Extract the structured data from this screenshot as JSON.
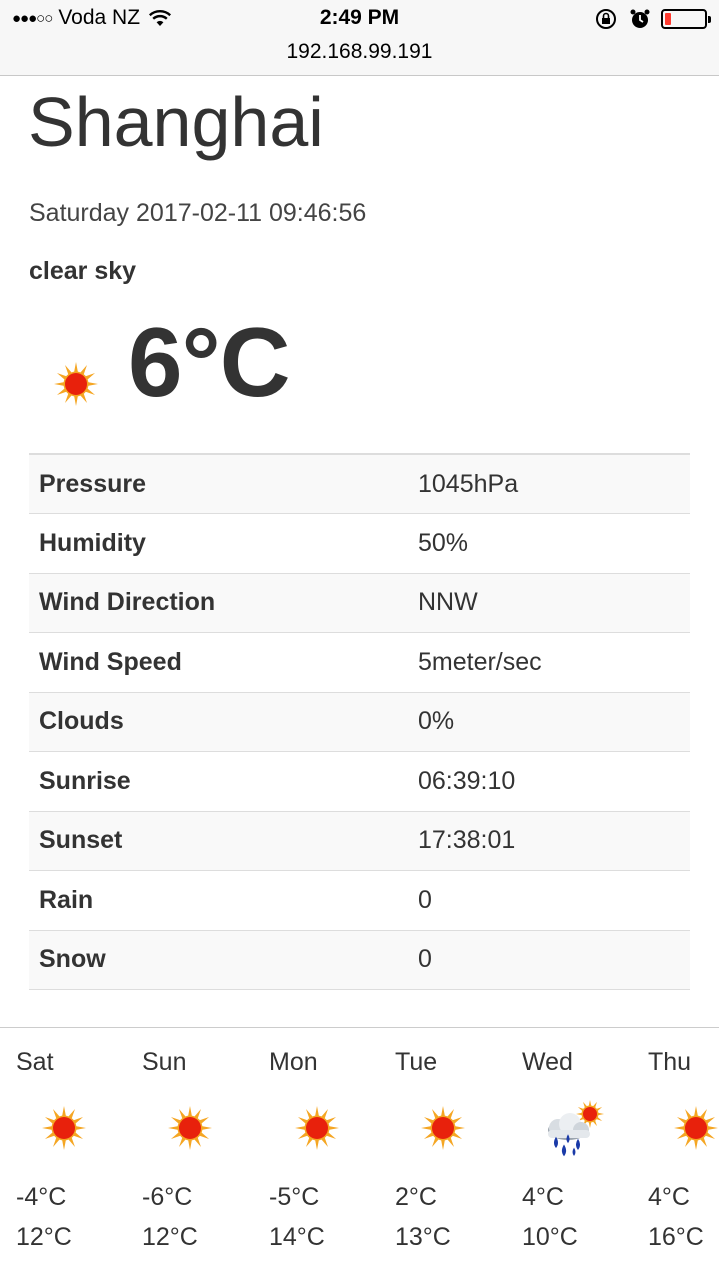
{
  "status_bar": {
    "signal": "●●●○○",
    "carrier": "Voda NZ",
    "time": "2:49 PM",
    "url": "192.168.99.191",
    "battery_level": 0.15,
    "battery_color": "#ff3b30",
    "icons": [
      "wifi-icon",
      "orientation-lock-icon",
      "alarm-icon",
      "battery-icon"
    ]
  },
  "weather": {
    "city": "Shanghai",
    "datetime": "Saturday 2017-02-11 09:46:56",
    "description": "clear sky",
    "temperature": "6°C",
    "icon": "sun-icon"
  },
  "details": [
    {
      "label": "Pressure",
      "value": "1045hPa"
    },
    {
      "label": "Humidity",
      "value": "50%"
    },
    {
      "label": "Wind Direction",
      "value": "NNW"
    },
    {
      "label": "Wind Speed",
      "value": "5meter/sec"
    },
    {
      "label": "Clouds",
      "value": "0%"
    },
    {
      "label": "Sunrise",
      "value": "06:39:10"
    },
    {
      "label": "Sunset",
      "value": "17:38:01"
    },
    {
      "label": "Rain",
      "value": "0"
    },
    {
      "label": "Snow",
      "value": "0"
    }
  ],
  "forecast": [
    {
      "day": "Sat",
      "low": "-4°C",
      "high": "12°C",
      "icon": "sun-icon"
    },
    {
      "day": "Sun",
      "low": "-6°C",
      "high": "12°C",
      "icon": "sun-icon"
    },
    {
      "day": "Mon",
      "low": "-5°C",
      "high": "14°C",
      "icon": "sun-icon"
    },
    {
      "day": "Tue",
      "low": "2°C",
      "high": "13°C",
      "icon": "sun-icon"
    },
    {
      "day": "Wed",
      "low": "4°C",
      "high": "10°C",
      "icon": "rain-cloud-sun-icon"
    },
    {
      "day": "Thu",
      "low": "4°C",
      "high": "16°C",
      "icon": "sun-icon"
    }
  ],
  "colors": {
    "sun_core": "#e8210c",
    "sun_rays": "#f5a623",
    "rain_drop": "#1a3aa8"
  }
}
